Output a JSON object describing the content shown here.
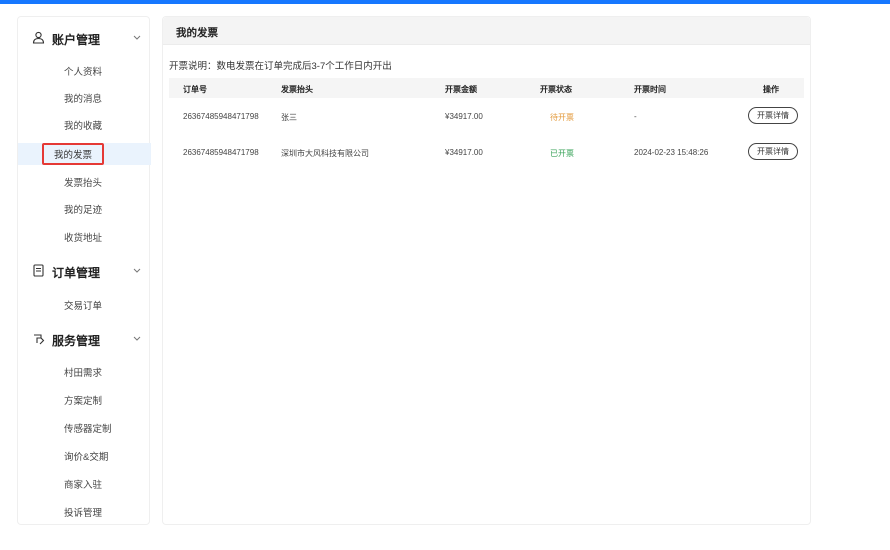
{
  "sidebar": {
    "groups": [
      {
        "title": "账户管理",
        "icon": "user-icon",
        "items": [
          "个人资料",
          "我的消息",
          "我的收藏",
          "我的发票",
          "发票抬头",
          "我的足迹",
          "收货地址"
        ]
      },
      {
        "title": "订单管理",
        "icon": "document-icon",
        "items": [
          "交易订单"
        ]
      },
      {
        "title": "服务管理",
        "icon": "service-icon",
        "items": [
          "村田需求",
          "方案定制",
          "传感器定制",
          "询价&交期",
          "商家入驻",
          "投诉管理"
        ]
      }
    ],
    "active_item": "我的发票"
  },
  "main": {
    "title": "我的发票",
    "note": "开票说明：数电发票在订单完成后3-7个工作日内开出",
    "columns": [
      "订单号",
      "发票抬头",
      "开票金额",
      "开票状态",
      "开票时间",
      "操作"
    ],
    "rows": [
      {
        "order_no": "26367485948471798",
        "invoice_title": "张三",
        "amount": "¥34917.00",
        "status": "待开票",
        "time": "-",
        "action": "开票详情"
      },
      {
        "order_no": "26367485948471798",
        "invoice_title": "深圳市大风科技有限公司",
        "amount": "¥34917.00",
        "status": "已开票",
        "time": "2024-02-23 15:48:26",
        "action": "开票详情"
      }
    ]
  },
  "colors": {
    "accent": "#1677ff",
    "highlight_border": "#e53935",
    "status_pending": "#e39a3b",
    "status_done": "#3aa35a"
  }
}
